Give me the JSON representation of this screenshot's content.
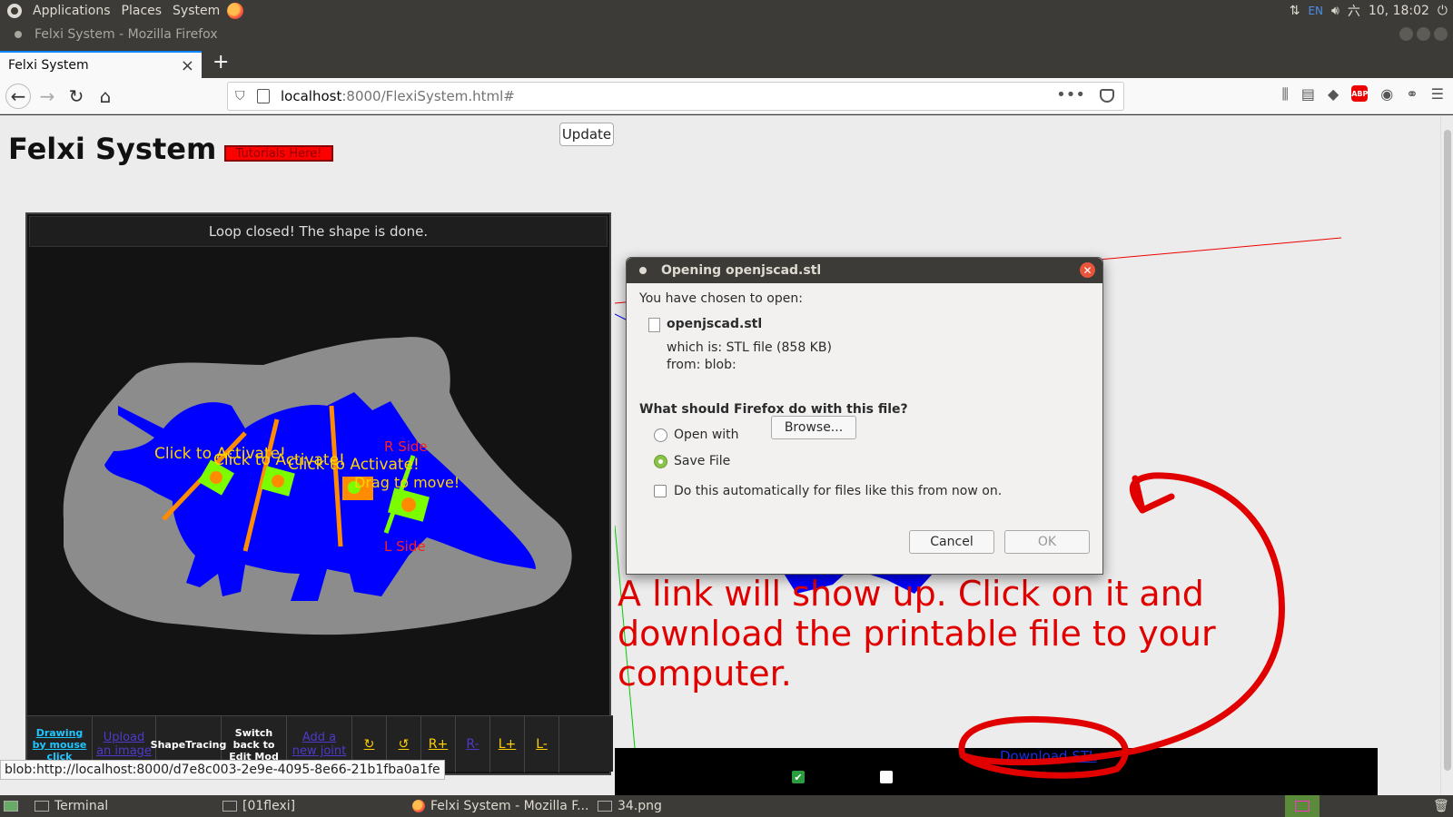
{
  "system_panel": {
    "menus": [
      "Applications",
      "Places",
      "System"
    ],
    "lang": "EN",
    "date": "六",
    "time": "10, 18:02"
  },
  "window": {
    "title": "Felxi System - Mozilla Firefox"
  },
  "browser": {
    "tab_title": "Felxi System",
    "tab_close": "×",
    "new_tab": "+",
    "url_host": "localhost",
    "url_path": ":8000/FlexiSystem.html#",
    "page_actions": "•••",
    "status_url": "blob:http://localhost:8000/d7e8c003-2e9e-4095-8e66-21b1fba0a1fe"
  },
  "page": {
    "title": "Felxi System",
    "tutorial_button": "Tutorials Here!",
    "status_message": "Loop closed! The shape is done.",
    "canvas_labels": {
      "click1": "Click to Activate!",
      "click2": "Click to Activate!",
      "click3": "Click to Activate!",
      "drag": "Drag to move!",
      "r_side": "R Side",
      "l_side": "L Side"
    },
    "tools": {
      "drawing": "Drawing by mouse click",
      "upload": "Upload an image",
      "shape_tracing": "ShapeTracing",
      "switch_back": "Switch back to Edit Mod",
      "add_joint": "Add a new joint",
      "rotate_cw": "↻",
      "rotate_ccw": "↺",
      "r_plus": "R+",
      "r_minus": "R-",
      "l_plus": "L+",
      "l_minus": "L-",
      "update": "Update"
    },
    "overlay_text": "A link will show up. Click on it and download the printable file to your computer.",
    "download_link": "Download STL"
  },
  "dialog": {
    "title": "Opening openjscad.stl",
    "chosen": "You have chosen to open:",
    "filename": "openjscad.stl",
    "which_is": "which is: STL file (858 KB)",
    "from": "from: blob:",
    "question": "What should Firefox do with this file?",
    "open_with": "Open with",
    "browse": "Browse...",
    "save_file": "Save File",
    "auto": "Do this automatically for files like this from now on.",
    "cancel": "Cancel",
    "ok": "OK",
    "selected_option": "Save File"
  },
  "taskbar": {
    "items": [
      "Terminal",
      "[01flexi]",
      "Felxi System - Mozilla F...",
      "34.png"
    ]
  },
  "colors": {
    "annotation_red": "#e00000",
    "shape_blue": "#0000ff",
    "joint_green": "#7cfc00",
    "joint_orange": "#ff8c00"
  }
}
